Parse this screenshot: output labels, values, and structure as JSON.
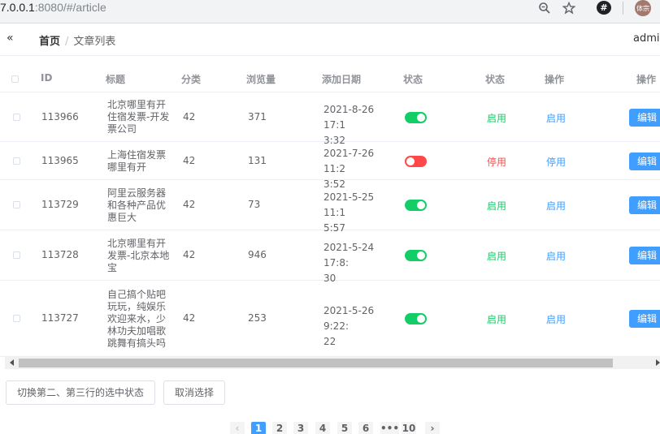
{
  "browser": {
    "url_host": "7.0.0.1",
    "url_rest": ":8080/#/article",
    "avatar_text": "体宗",
    "extension_glyph": "#"
  },
  "header": {
    "collapse_glyph": "«",
    "breadcrumb": {
      "home": "首页",
      "separator": "/",
      "current": "文章列表"
    },
    "user": "admin"
  },
  "table": {
    "columns": [
      "ID",
      "标题",
      "分类",
      "浏览量",
      "添加日期",
      "状态",
      "状态",
      "操作",
      "操作"
    ],
    "rows": [
      {
        "id": "113966",
        "title": [
          "北京哪里有开",
          "住宿发票-开发",
          "票公司"
        ],
        "category": "42",
        "views": "371",
        "date": [
          "2021-8-26 17:1",
          "3:32"
        ],
        "enabled": true,
        "status_text": "启用",
        "op_text": "启用",
        "edit_label": "编辑"
      },
      {
        "id": "113965",
        "title": [
          "上海住宿发票",
          "哪里有开"
        ],
        "category": "42",
        "views": "131",
        "date": [
          "2021-7-26 11:2",
          "3:52"
        ],
        "enabled": false,
        "status_text": "停用",
        "op_text": "停用",
        "edit_label": "编辑"
      },
      {
        "id": "113729",
        "title": [
          "阿里云服务器",
          "和各种产品优",
          "惠巨大"
        ],
        "category": "42",
        "views": "73",
        "date": [
          "2021-5-25 11:1",
          "5:57"
        ],
        "enabled": true,
        "status_text": "启用",
        "op_text": "启用",
        "edit_label": "编辑"
      },
      {
        "id": "113728",
        "title": [
          "北京哪里有开",
          "发票-北京本地",
          "宝"
        ],
        "category": "42",
        "views": "946",
        "date": [
          "2021-5-24 17:8:",
          "30"
        ],
        "enabled": true,
        "status_text": "启用",
        "op_text": "启用",
        "edit_label": "编辑"
      },
      {
        "id": "113727",
        "title": [
          "自己搞个贴吧",
          "玩玩，纯娱乐",
          "欢迎来水，少",
          "林功夫加唱歌",
          "跳舞有搞头吗"
        ],
        "category": "42",
        "views": "253",
        "date": [
          "2021-5-26 9:22:",
          "22"
        ],
        "enabled": true,
        "status_text": "启用",
        "op_text": "启用",
        "edit_label": "编辑"
      }
    ]
  },
  "actions": {
    "toggle_label": "切换第二、第三行的选中状态",
    "clear_label": "取消选择"
  },
  "pagination": {
    "prev": "‹",
    "pages": [
      "1",
      "2",
      "3",
      "4",
      "5",
      "6",
      "•••",
      "10"
    ],
    "current": "1",
    "next": "›"
  },
  "colors": {
    "primary": "#409eff",
    "success": "#13ce66",
    "danger": "#ff4949"
  }
}
